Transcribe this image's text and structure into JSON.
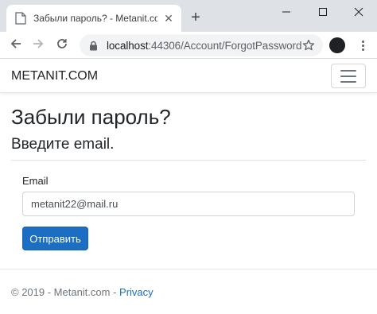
{
  "browser": {
    "tab": {
      "title": "Забыли пароль? - Metanit.com"
    },
    "new_tab_label": "+",
    "url": {
      "host": "localhost",
      "path": ":44306/Account/ForgotPassword"
    },
    "profile_label": "",
    "icons": {
      "favicon": "page-icon",
      "close": "close-icon",
      "back": "arrow-left-icon",
      "forward": "arrow-right-icon",
      "reload": "reload-icon",
      "lock": "lock-icon",
      "star": "star-icon",
      "menu": "more-vertical-icon"
    }
  },
  "navbar": {
    "brand": "METANIT.COM",
    "toggler_icon": "hamburger-icon"
  },
  "page": {
    "title": "Забыли пароль?",
    "subtitle": "Введите email."
  },
  "form": {
    "email_label": "Email",
    "email_value": "metanit22@mail.ru",
    "submit_label": "Отправить"
  },
  "footer": {
    "text": "© 2019 - Metanit.com - ",
    "privacy_link": "Privacy"
  },
  "colors": {
    "primary": "#1b6ec2",
    "chrome_bg": "#dee1e6",
    "omnibox_bg": "#f1f3f4"
  }
}
